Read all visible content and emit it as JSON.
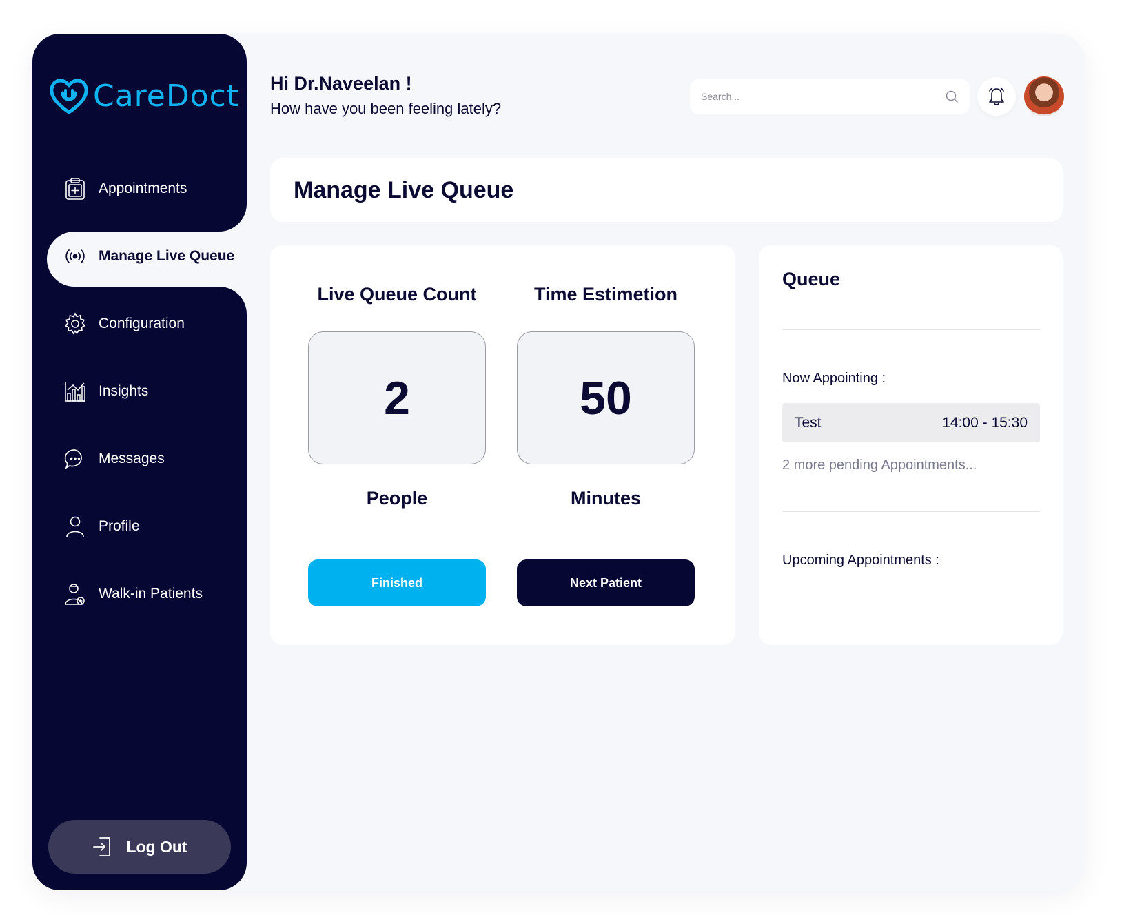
{
  "brand": {
    "name": "CareDoct",
    "color": "#11b2f0"
  },
  "sidebar": {
    "bg_color": "#070734",
    "items": [
      {
        "label": "Appointments",
        "icon": "clipboard-medical-icon"
      },
      {
        "label": "Manage Live Queue",
        "icon": "broadcast-icon",
        "active": true
      },
      {
        "label": "Configuration",
        "icon": "gear-icon"
      },
      {
        "label": "Insights",
        "icon": "bar-chart-icon"
      },
      {
        "label": "Messages",
        "icon": "chat-bubble-icon"
      },
      {
        "label": "Profile",
        "icon": "user-icon"
      },
      {
        "label": "Walk-in Patients",
        "icon": "doctor-icon"
      }
    ],
    "logout": {
      "label": "Log Out",
      "icon": "logout-icon"
    }
  },
  "header": {
    "greeting": "Hi Dr.Naveelan !",
    "subtitle": "How have you been feeling lately?",
    "search_placeholder": "Search...",
    "search_icon": "search-icon",
    "bell_icon": "bell-icon",
    "avatar": "user-avatar"
  },
  "page": {
    "title": "Manage Live Queue"
  },
  "live_queue": {
    "count_heading": "Live Queue Count",
    "count_value": "2",
    "count_unit": "People",
    "time_heading": "Time Estimetion",
    "time_value": "50",
    "time_unit": "Minutes",
    "finished_label": "Finished",
    "next_label": "Next Patient",
    "accent_color": "#00b1ef"
  },
  "queue": {
    "title": "Queue",
    "now_label": "Now Appointing :",
    "now_name": "Test",
    "now_time": "14:00 - 15:30",
    "pending_text": "2 more pending Appointments...",
    "upcoming_label": "Upcoming Appointments :"
  }
}
